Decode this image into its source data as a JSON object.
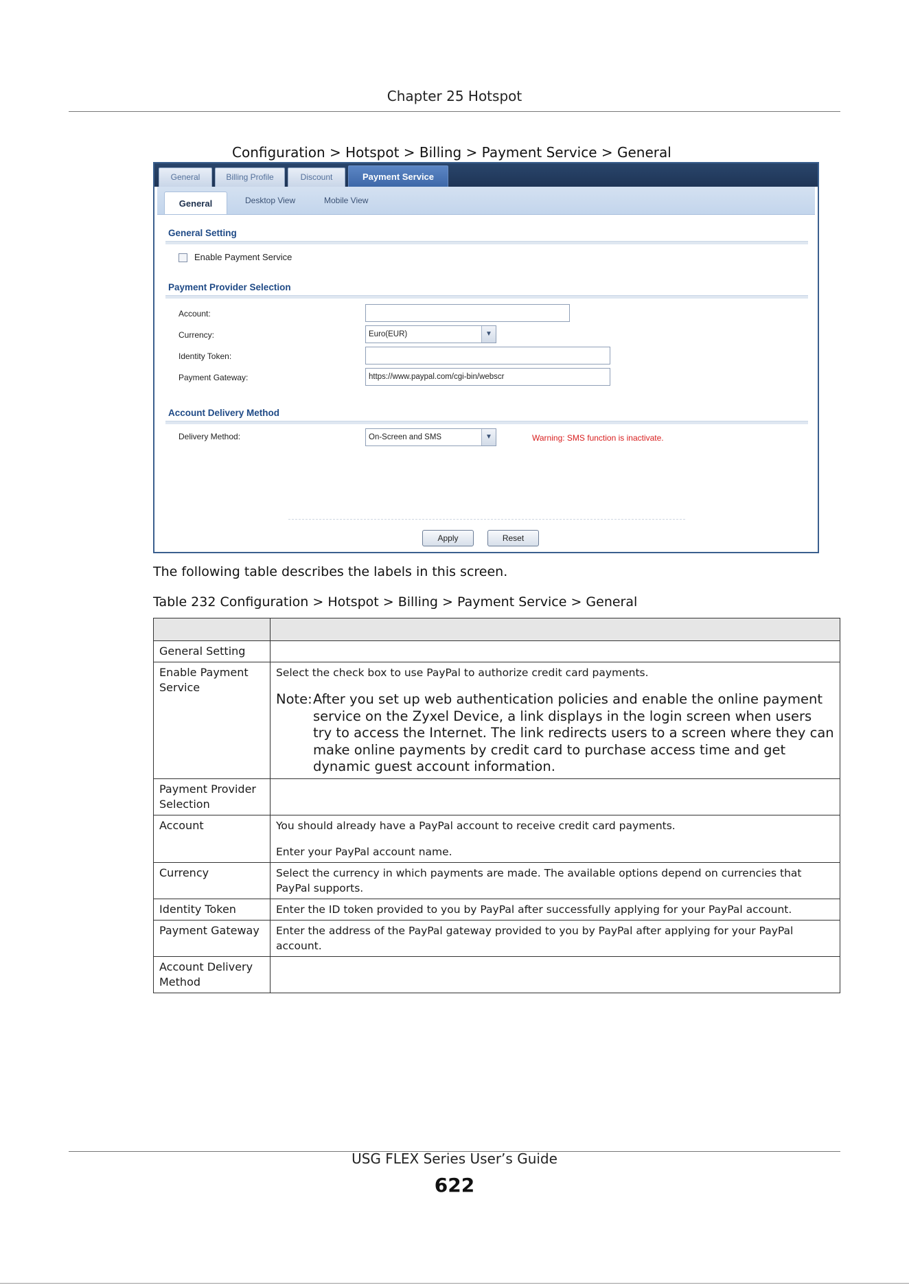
{
  "header": {
    "chapter": "Chapter 25 Hotspot"
  },
  "figure": {
    "caption": "Configuration > Hotspot > Billing > Payment Service > General"
  },
  "screen": {
    "top_tabs": [
      {
        "label": "General"
      },
      {
        "label": "Billing Profile"
      },
      {
        "label": "Discount"
      },
      {
        "label": "Payment Service",
        "active": true
      }
    ],
    "sub_tabs": [
      {
        "label": "General",
        "active": true
      },
      {
        "label": "Desktop View"
      },
      {
        "label": "Mobile View"
      }
    ],
    "general_setting": {
      "title": "General Setting",
      "enable_label": "Enable Payment Service",
      "enable_checked": false
    },
    "provider": {
      "title": "Payment Provider Selection",
      "account_label": "Account:",
      "account_value": "",
      "currency_label": "Currency:",
      "currency_value": "Euro(EUR)",
      "token_label": "Identity Token:",
      "token_value": "",
      "gateway_label": "Payment Gateway:",
      "gateway_value": "https://www.paypal.com/cgi-bin/webscr"
    },
    "delivery": {
      "title": "Account Delivery Method",
      "method_label": "Delivery Method:",
      "method_value": "On-Screen and SMS",
      "warning": "Warning: SMS function is inactivate."
    },
    "buttons": {
      "apply": "Apply",
      "reset": "Reset"
    },
    "colors": {
      "tab_bar": "#1f3556",
      "section_title": "#1f4a86",
      "warning": "#d81e1e"
    }
  },
  "intro": "The following table describes the labels in this screen.",
  "table": {
    "caption": "Table 232   Configuration > Hotspot > Billing > Payment Service > General",
    "header": {
      "label": "",
      "description": ""
    },
    "rows": [
      {
        "label": "General Setting",
        "desc": []
      },
      {
        "label": "Enable Payment Service",
        "desc": [
          "Select the check box to use PayPal to authorize credit card payments."
        ],
        "note_head": "Note:",
        "note": "After you set up web authentication policies and enable the online payment service on the Zyxel Device, a link displays in the login screen when users try to access the Internet. The link redirects users to a screen where they can make online payments by credit card to purchase access time and get dynamic guest account information."
      },
      {
        "label": "Payment Provider Selection",
        "desc": []
      },
      {
        "label": "Account",
        "desc": [
          "You should already have a PayPal account to receive credit card payments.",
          "Enter your PayPal account name."
        ]
      },
      {
        "label": "Currency",
        "desc": [
          "Select the currency in which payments are made. The available options depend on currencies that PayPal supports."
        ]
      },
      {
        "label": "Identity Token",
        "desc": [
          "Enter the ID token provided to you by PayPal after successfully applying for your PayPal account."
        ]
      },
      {
        "label": "Payment Gateway",
        "desc": [
          "Enter the address of the PayPal gateway provided to you by PayPal after applying for your PayPal account."
        ]
      },
      {
        "label": "Account Delivery Method",
        "desc": []
      }
    ]
  },
  "footer": {
    "title": "USG FLEX Series User’s Guide",
    "page": "622"
  }
}
